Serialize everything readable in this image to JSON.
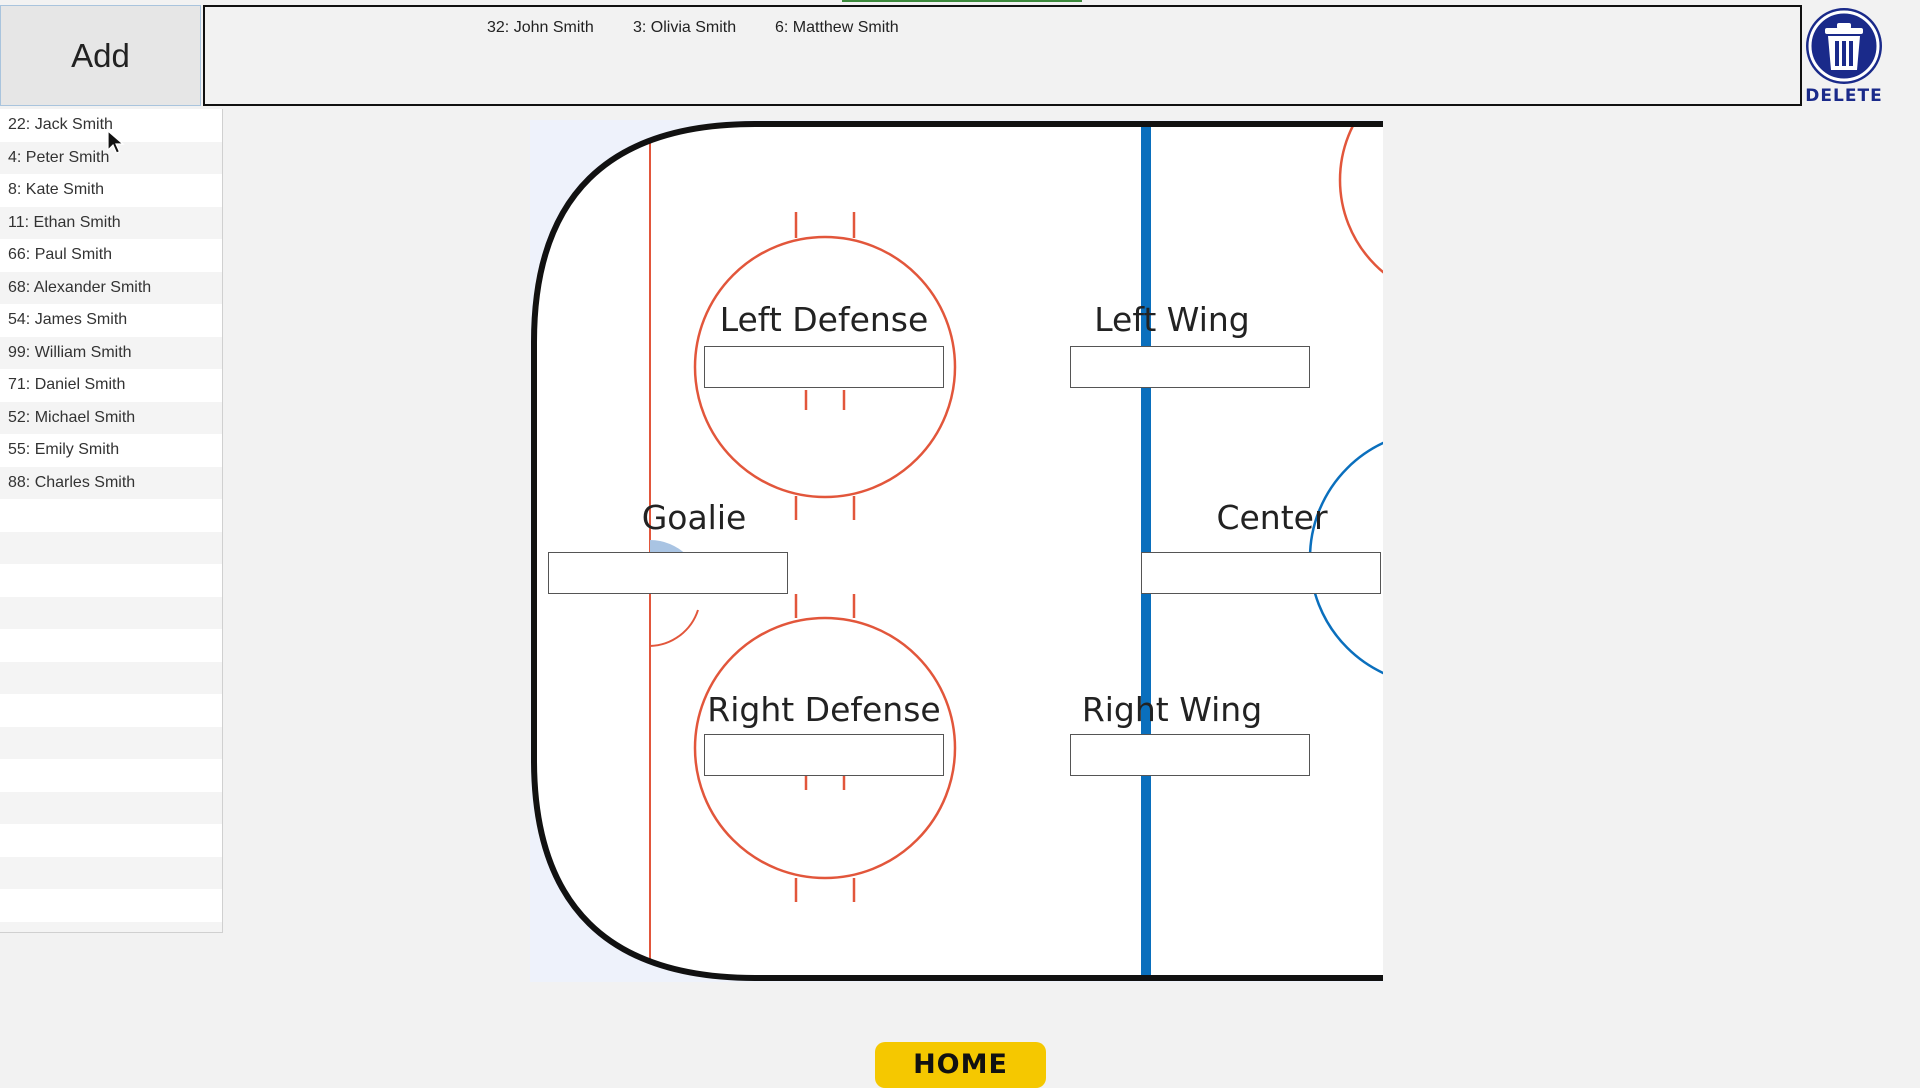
{
  "toolbar": {
    "add_label": "Add",
    "delete_label": "DELETE"
  },
  "selected_players": [
    "32: John Smith",
    "3: Olivia Smith",
    "6: Matthew Smith"
  ],
  "roster": [
    "22: Jack Smith",
    "4: Peter Smith",
    "8: Kate Smith",
    "11: Ethan Smith",
    "66: Paul Smith",
    "68: Alexander Smith",
    "54: James Smith",
    "99: William Smith",
    "71: Daniel Smith",
    "52: Michael Smith",
    "55: Emily Smith",
    "88: Charles Smith"
  ],
  "positions": {
    "left_defense": {
      "label": "Left Defense",
      "value": ""
    },
    "left_wing": {
      "label": "Left Wing",
      "value": ""
    },
    "goalie": {
      "label": "Goalie",
      "value": ""
    },
    "center": {
      "label": "Center",
      "value": ""
    },
    "right_defense": {
      "label": "Right Defense",
      "value": ""
    },
    "right_wing": {
      "label": "Right Wing",
      "value": ""
    }
  },
  "footer": {
    "home_label": "HOME"
  },
  "colors": {
    "faceoff_red": "#e2563b",
    "blue_line": "#0a6fbd",
    "home_yellow": "#f5c800",
    "delete_navy": "#1a2a8a"
  },
  "icons": {
    "delete": "trash-icon",
    "cursor": "mouse-pointer-icon"
  }
}
